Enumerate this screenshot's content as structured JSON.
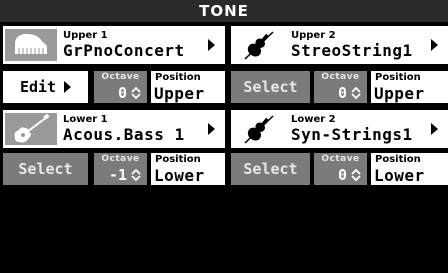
{
  "header": {
    "title": "TONE"
  },
  "upper1": {
    "part": "Upper 1",
    "tone": "GrPnoConcert",
    "icon": "piano-icon",
    "action": "Edit",
    "octave_label": "Octave",
    "octave": "0",
    "position_label": "Position",
    "position": "Upper"
  },
  "upper2": {
    "part": "Upper 2",
    "tone": "StreoString1",
    "icon": "violin-icon",
    "action": "Select",
    "octave_label": "Octave",
    "octave": "0",
    "position_label": "Position",
    "position": "Upper"
  },
  "lower1": {
    "part": "Lower 1",
    "tone": "Acous.Bass 1",
    "icon": "guitar-icon",
    "action": "Select",
    "octave_label": "Octave",
    "octave": "-1",
    "position_label": "Position",
    "position": "Lower"
  },
  "lower2": {
    "part": "Lower 2",
    "tone": "Syn-Strings1",
    "icon": "violin-icon",
    "action": "Select",
    "octave_label": "Octave",
    "octave": "0",
    "position_label": "Position",
    "position": "Lower"
  }
}
